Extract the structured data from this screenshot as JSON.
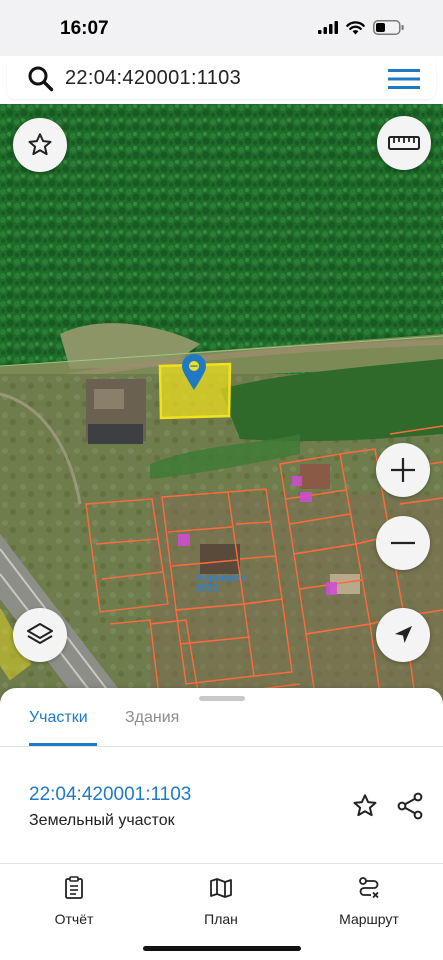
{
  "status_bar": {
    "time": "16:07"
  },
  "search": {
    "query": "22:04:420001:1103"
  },
  "map": {
    "watermark_line1": "Аэрофото",
    "watermark_line2": "2023",
    "colors": {
      "parcel_highlight": "#f2e21c",
      "cadastre_lines": "#ff6a3d",
      "marker": "#1f7ac6"
    }
  },
  "sheet": {
    "tabs": [
      {
        "label": "Участки",
        "active": true
      },
      {
        "label": "Здания",
        "active": false
      }
    ],
    "parcel": {
      "number": "22:04:420001:1103",
      "type": "Земельный участок"
    }
  },
  "bottom_nav": [
    {
      "label": "Отчёт",
      "icon": "report-icon"
    },
    {
      "label": "План",
      "icon": "map-plan-icon"
    },
    {
      "label": "Маршрут",
      "icon": "route-icon"
    }
  ]
}
